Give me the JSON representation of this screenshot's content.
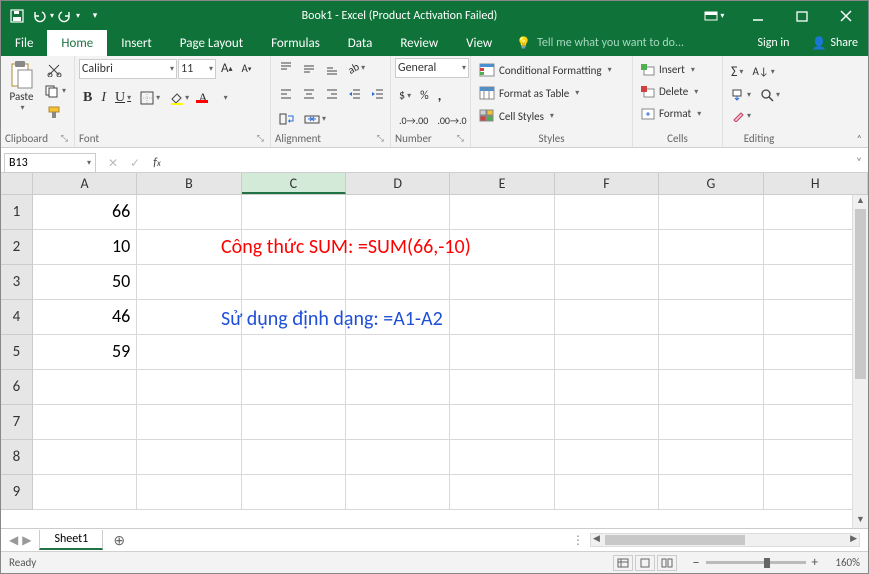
{
  "title": "Book1 - Excel (Product Activation Failed)",
  "tabs": [
    "File",
    "Home",
    "Insert",
    "Page Layout",
    "Formulas",
    "Data",
    "Review",
    "View"
  ],
  "tellme": "Tell me what you want to do...",
  "signin": "Sign in",
  "share": "Share",
  "ribbon": {
    "clipboard": {
      "paste": "Paste",
      "label": "Clipboard"
    },
    "font": {
      "name": "Calibri",
      "size": "11",
      "increase": "A",
      "decrease": "A",
      "label": "Font"
    },
    "alignment": {
      "label": "Alignment"
    },
    "number": {
      "format": "General",
      "label": "Number"
    },
    "styles": {
      "cond": "Conditional Formatting",
      "table": "Format as Table",
      "cell": "Cell Styles",
      "label": "Styles"
    },
    "cells": {
      "insert": "Insert",
      "delete": "Delete",
      "format": "Format",
      "label": "Cells"
    },
    "editing": {
      "label": "Editing"
    }
  },
  "namebox": "B13",
  "formula": "",
  "columns": [
    "A",
    "B",
    "C",
    "D",
    "E",
    "F",
    "G",
    "H"
  ],
  "row_headers": [
    "1",
    "2",
    "3",
    "4",
    "5",
    "6",
    "7",
    "8",
    "9"
  ],
  "cells": {
    "A1": "66",
    "A2": "10",
    "A3": "50",
    "A4": "46",
    "A5": "59"
  },
  "overlays": {
    "red": "Công thức SUM: =SUM(66,-10)",
    "blue": "Sử dụng định dạng: =A1-A2"
  },
  "sheet": "Sheet1",
  "status": "Ready",
  "zoom": "160%"
}
